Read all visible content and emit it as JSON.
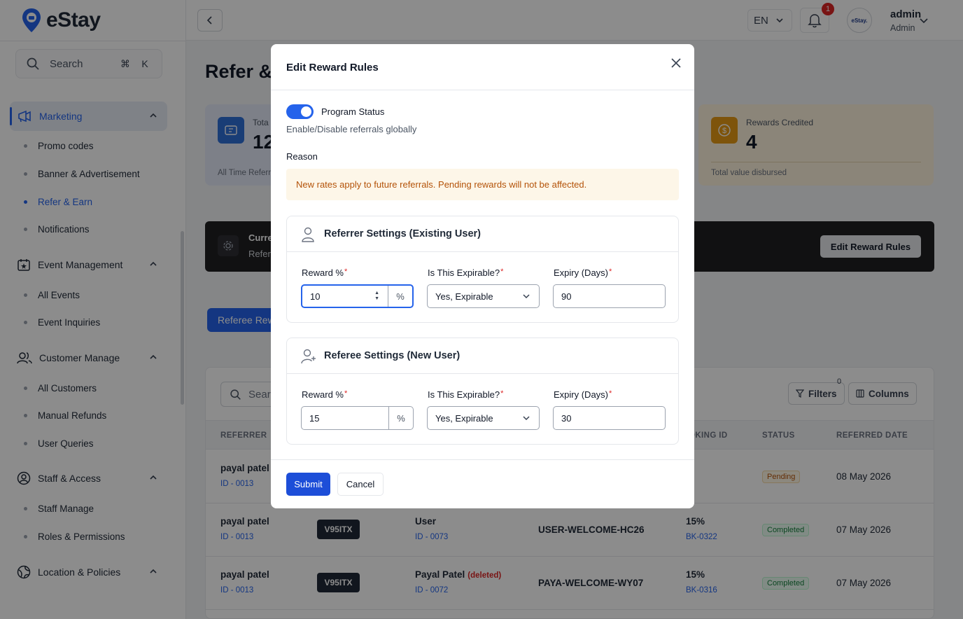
{
  "app": {
    "name": "eStay"
  },
  "search": {
    "placeholder": "Search",
    "shortcut_mod": "⌘",
    "shortcut_key": "K"
  },
  "sidebar": {
    "groups": [
      {
        "label": "Marketing",
        "icon": "megaphone-icon",
        "items": [
          "Promo codes",
          "Banner & Advertisement",
          "Refer & Earn",
          "Notifications"
        ],
        "active_item": "Refer & Earn"
      },
      {
        "label": "Event Management",
        "icon": "calendar-star-icon",
        "items": [
          "All Events",
          "Event Inquiries"
        ]
      },
      {
        "label": "Customer Manage",
        "icon": "users-icon",
        "items": [
          "All Customers",
          "Manual Refunds",
          "User Queries"
        ]
      },
      {
        "label": "Staff & Access",
        "icon": "user-circle-icon",
        "items": [
          "Staff Manage",
          "Roles & Permissions"
        ]
      },
      {
        "label": "Location & Policies",
        "icon": "globe-icon",
        "items": []
      }
    ]
  },
  "topbar": {
    "language": "EN",
    "notification_count": "1",
    "avatar_text": "eStay.",
    "user_name": "admin",
    "user_role": "Admin"
  },
  "page": {
    "title": "Refer & Earn",
    "title_visible": "Refer &",
    "stat_left": {
      "label": "Tota",
      "value": "12",
      "foot": "All Time Referr"
    },
    "stat_right": {
      "label": "Rewards Credited",
      "value": "4",
      "foot": "Total value disbursed"
    },
    "current_bar": {
      "title": "Curre",
      "subtitle": "Refer",
      "button": "Edit Reward Rules"
    },
    "tab_active": "Referee Rew",
    "table": {
      "search_placeholder": "Searc",
      "filters_label": "Filters",
      "filters_count": "0",
      "columns_label": "Columns",
      "headers": [
        "REFERRER",
        "OKING ID",
        "STATUS",
        "REFERRED DATE"
      ],
      "rows": [
        {
          "referrer": "payal patel",
          "referrer_id": "ID - 0013",
          "code": "",
          "user": "",
          "user_deleted": "",
          "user_id": "",
          "welcome_code": "",
          "pct": "",
          "booking": "",
          "status": "Pending",
          "status_type": "pending",
          "date": "08 May 2026"
        },
        {
          "referrer": "payal patel",
          "referrer_id": "ID - 0013",
          "code": "V95ITX",
          "user": "User",
          "user_deleted": "",
          "user_id": "ID - 0073",
          "welcome_code": "USER-WELCOME-HC26",
          "pct": "15%",
          "booking": "BK-0322",
          "status": "Completed",
          "status_type": "completed",
          "date": "07 May 2026"
        },
        {
          "referrer": "payal patel",
          "referrer_id": "ID - 0013",
          "code": "V95ITX",
          "user": "Payal Patel",
          "user_deleted": "(deleted)",
          "user_id": "ID - 0072",
          "welcome_code": "PAYA-WELCOME-WY07",
          "pct": "15%",
          "booking": "BK-0316",
          "status": "Completed",
          "status_type": "completed",
          "date": "07 May 2026"
        }
      ]
    }
  },
  "modal": {
    "title": "Edit Reward Rules",
    "program_status_label": "Program Status",
    "program_status_enabled": true,
    "program_status_desc": "Enable/Disable referrals globally",
    "reason_label": "Reason",
    "notice": "New rates apply to future referrals. Pending rewards will not be affected.",
    "referrer": {
      "title": "Referrer Settings (Existing User)",
      "reward_label": "Reward %",
      "reward_value": "10",
      "reward_suffix": "%",
      "expirable_label": "Is This Expirable?",
      "expirable_value": "Yes, Expirable",
      "expiry_label": "Expiry (Days)",
      "expiry_value": "90"
    },
    "referee": {
      "title": "Referee Settings (New User)",
      "reward_label": "Reward %",
      "reward_value": "15",
      "reward_suffix": "%",
      "expirable_label": "Is This Expirable?",
      "expirable_value": "Yes, Expirable",
      "expiry_label": "Expiry (Days)",
      "expiry_value": "30"
    },
    "required_mark": "*",
    "submit_label": "Submit",
    "cancel_label": "Cancel"
  },
  "colors": {
    "accent": "#2563eb",
    "notice_bg": "#fdf6e8",
    "notice_text": "#b45309",
    "overlay": "rgba(0,0,0,0.45)"
  }
}
